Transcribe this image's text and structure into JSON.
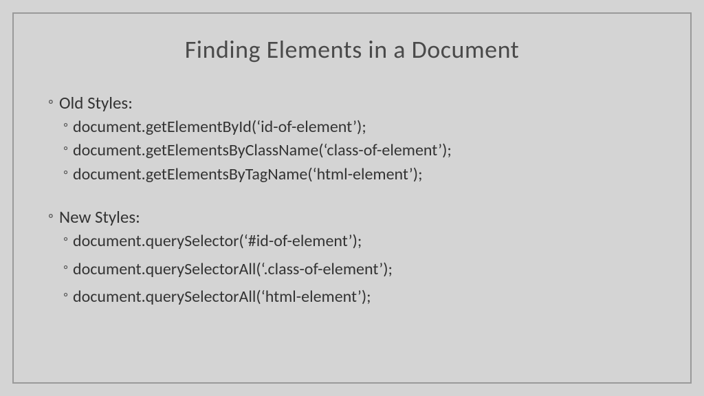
{
  "title": "Finding Elements in a Document",
  "sections": {
    "old": {
      "header": "Old Styles:",
      "items": [
        "document.getElementById(‘id-of-element’);",
        "document.getElementsByClassName(‘class-of-element’);",
        "document.getElementsByTagName(‘html-element’);"
      ]
    },
    "new": {
      "header": "New Styles:",
      "items": [
        "document.querySelector(‘#id-of-element’);",
        "document.querySelectorAll(‘.class-of-element’);",
        "document.querySelectorAll(‘html-element’);"
      ]
    }
  }
}
